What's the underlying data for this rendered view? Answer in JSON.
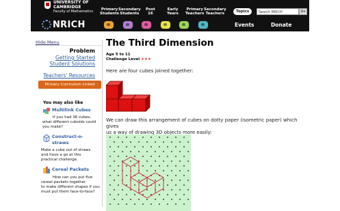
{
  "header": {
    "university": "UNIVERSITY OF",
    "cambridge": "CAMBRIDGE",
    "faculty": "Faculty of Mathematics",
    "nav": [
      {
        "line1": "Primary",
        "line2": "Students"
      },
      {
        "line1": "Secondary",
        "line2": "Students"
      },
      {
        "line1": "Post",
        "line2": "16"
      },
      {
        "line1": "Early",
        "line2": "Years"
      },
      {
        "line1": "Primary",
        "line2": "Teachers"
      },
      {
        "line1": "Secondary",
        "line2": "Teachers"
      }
    ],
    "topics_label": "Topics",
    "search_placeholder": "Search NRICH",
    "go_label": "Go"
  },
  "nrich": {
    "logo_text": "NRICH",
    "stage_colors": [
      "#e8a33a",
      "#b07fd1",
      "#e05aa0",
      "#e8e24c",
      "#9fd65a",
      "#4fb8c8"
    ],
    "events_label": "Events",
    "donate_label": "Donate"
  },
  "sidebar": {
    "hide_menu": "Hide Menu",
    "section_title": "Problem",
    "links": [
      "Getting Started",
      "Student Solutions",
      "Teachers' Resources"
    ],
    "curriculum_button": "Primary Curriculum Linked",
    "may_also_like": "You may also like",
    "related": [
      {
        "title": "Multilink Cubes",
        "desc": [
          "If you had 36 cubes,",
          "what different cuboids could",
          "you make?"
        ]
      },
      {
        "title": "Construct-o-",
        "title2": "straws",
        "desc": [
          "Make a cube out of straws",
          "and have a go at this",
          "practical challenge."
        ]
      },
      {
        "title": "Cereal Packets",
        "desc": [
          "How can you put five",
          "cereal packets together",
          "to make different shapes if you",
          "must put them face-to-face?"
        ]
      }
    ]
  },
  "main": {
    "title": "The Third Dimension",
    "age": "Age 5 to 11",
    "challenge_label": "Challenge Level",
    "challenge_stars": "★★★",
    "intro": "Here are four cubes joined together:",
    "iso_text_1": "We can draw this arrangement of cubes on dotty paper (isometric paper) which gives",
    "iso_text_2": "us a way of drawing 3D objects more easily:"
  }
}
